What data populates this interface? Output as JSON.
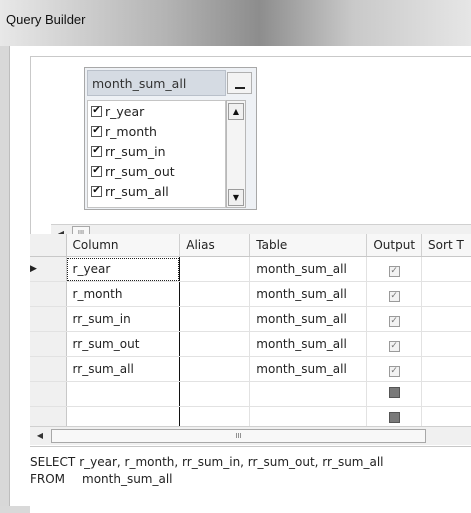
{
  "window": {
    "title": "Query Builder"
  },
  "diagram": {
    "table_name": "month_sum_all",
    "columns": [
      "r_year",
      "r_month",
      "rr_sum_in",
      "rr_sum_out",
      "rr_sum_all"
    ],
    "checked": [
      true,
      true,
      true,
      true,
      true
    ],
    "h_thumb_glyph": "III"
  },
  "grid": {
    "headers": {
      "column": "Column",
      "alias": "Alias",
      "table": "Table",
      "output": "Output",
      "sort_type": "Sort T"
    },
    "rows": [
      {
        "column": "r_year",
        "alias": "",
        "table": "month_sum_all",
        "output": true
      },
      {
        "column": "r_month",
        "alias": "",
        "table": "month_sum_all",
        "output": true
      },
      {
        "column": "rr_sum_in",
        "alias": "",
        "table": "month_sum_all",
        "output": true
      },
      {
        "column": "rr_sum_out",
        "alias": "",
        "table": "month_sum_all",
        "output": true
      },
      {
        "column": "rr_sum_all",
        "alias": "",
        "table": "month_sum_all",
        "output": true
      },
      {
        "column": "",
        "alias": "",
        "table": "",
        "output": false
      },
      {
        "column": "",
        "alias": "",
        "table": "",
        "output": false
      }
    ],
    "h_thumb_glyph": "III"
  },
  "sql": {
    "select_keyword": "SELECT",
    "select_columns": "r_year, r_month, rr_sum_in, rr_sum_out, rr_sum_all",
    "from_keyword": "FROM",
    "from_table": "month_sum_all"
  },
  "colors": {
    "titlebar_mid": "#8d8d8d",
    "table_header": "#d5dbe3",
    "grid_line": "#e2e2e2"
  }
}
